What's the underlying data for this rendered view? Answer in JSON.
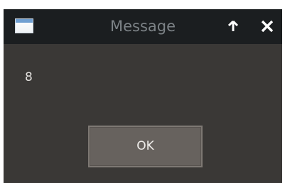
{
  "window": {
    "title": "Message",
    "app_icon": "window-icon",
    "controls": [
      {
        "name": "keep-above-button",
        "icon": "arrow-up-icon"
      },
      {
        "name": "close-button",
        "icon": "close-icon"
      }
    ]
  },
  "dialog": {
    "message": "8",
    "ok_label": "OK"
  },
  "colors": {
    "titlebar_bg": "#1b1e20",
    "title_text": "#7c8286",
    "body_bg": "#3a3836",
    "button_bg": "#67625e",
    "button_border": "#7d7873",
    "text": "#e2e0dd"
  }
}
